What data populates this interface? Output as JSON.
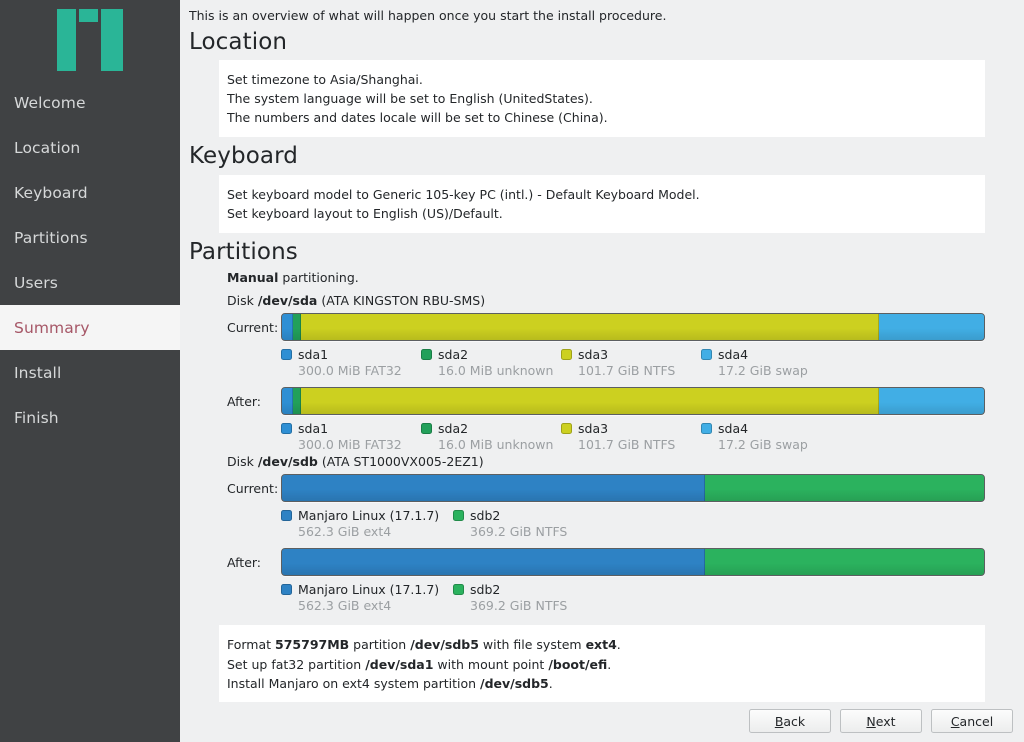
{
  "sidebar": {
    "logo_name": "manjaro-logo",
    "logo_color": "#2ab597",
    "background": "#404244",
    "items": [
      {
        "label": "Welcome",
        "active": false
      },
      {
        "label": "Location",
        "active": false
      },
      {
        "label": "Keyboard",
        "active": false
      },
      {
        "label": "Partitions",
        "active": false
      },
      {
        "label": "Users",
        "active": false
      },
      {
        "label": "Summary",
        "active": true
      },
      {
        "label": "Install",
        "active": false
      },
      {
        "label": "Finish",
        "active": false
      }
    ],
    "active_text_color": "#a65767",
    "active_bg_color": "#f5f5f5"
  },
  "main": {
    "intro": "This is an overview of what will happen once you start the install procedure.",
    "sections": {
      "location": {
        "title": "Location",
        "lines": [
          "Set timezone to Asia/Shanghai.",
          "The system language will be set to English (UnitedStates).",
          "The numbers and dates locale will be set to Chinese (China)."
        ]
      },
      "keyboard": {
        "title": "Keyboard",
        "lines": [
          "Set keyboard model to Generic 105-key PC (intl.) - Default Keyboard Model.",
          "Set keyboard layout to English (US)/Default."
        ]
      },
      "partitions": {
        "title": "Partitions",
        "mode_bold": "Manual",
        "mode_rest": " partitioning.",
        "current_label": "Current:",
        "after_label": "After:",
        "disks": [
          {
            "prefix": "Disk ",
            "device": "/dev/sda",
            "model": " (ATA KINGSTON RBU-SMS)",
            "current": [
              {
                "name": "sda1",
                "size": "300.0 MiB",
                "fs": "FAT32",
                "color": "#2e8fd4",
                "pct": 1.6
              },
              {
                "name": "sda2",
                "size": "16.0 MiB",
                "fs": "unknown",
                "color": "#22a05a",
                "pct": 1.1
              },
              {
                "name": "sda3",
                "size": "101.7 GiB",
                "fs": "NTFS",
                "color": "#ccd020",
                "pct": 82.3
              },
              {
                "name": "sda4",
                "size": "17.2 GiB",
                "fs": "swap",
                "color": "#41aee5",
                "pct": 15.0
              }
            ],
            "after": [
              {
                "name": "sda1",
                "size": "300.0 MiB",
                "fs": "FAT32",
                "color": "#2e8fd4",
                "pct": 1.6
              },
              {
                "name": "sda2",
                "size": "16.0 MiB",
                "fs": "unknown",
                "color": "#22a05a",
                "pct": 1.1
              },
              {
                "name": "sda3",
                "size": "101.7 GiB",
                "fs": "NTFS",
                "color": "#ccd020",
                "pct": 82.3
              },
              {
                "name": "sda4",
                "size": "17.2 GiB",
                "fs": "swap",
                "color": "#41aee5",
                "pct": 15.0
              }
            ]
          },
          {
            "prefix": "Disk ",
            "device": "/dev/sdb",
            "model": " (ATA ST1000VX005-2EZ1)",
            "current": [
              {
                "name": "Manjaro Linux (17.1.7)",
                "size": "562.3 GiB",
                "fs": "ext4",
                "color": "#2e82c4",
                "pct": 60.3
              },
              {
                "name": "sdb2",
                "size": "369.2 GiB",
                "fs": "NTFS",
                "color": "#2bb25e",
                "pct": 39.7
              }
            ],
            "after": [
              {
                "name": "Manjaro Linux (17.1.7)",
                "size": "562.3 GiB",
                "fs": "ext4",
                "color": "#2e82c4",
                "pct": 60.3
              },
              {
                "name": "sdb2",
                "size": "369.2 GiB",
                "fs": "NTFS",
                "color": "#2bb25e",
                "pct": 39.7
              }
            ]
          }
        ],
        "actions": [
          [
            {
              "t": "Format ",
              "b": false
            },
            {
              "t": "575797MB",
              "b": true
            },
            {
              "t": " partition ",
              "b": false
            },
            {
              "t": "/dev/sdb5",
              "b": true
            },
            {
              "t": " with file system ",
              "b": false
            },
            {
              "t": "ext4",
              "b": true
            },
            {
              "t": ".",
              "b": false
            }
          ],
          [
            {
              "t": "Set up fat32 partition ",
              "b": false
            },
            {
              "t": "/dev/sda1",
              "b": true
            },
            {
              "t": " with mount point ",
              "b": false
            },
            {
              "t": "/boot/efi",
              "b": true
            },
            {
              "t": ".",
              "b": false
            }
          ],
          [
            {
              "t": "Install Manjaro on ext4 system partition ",
              "b": false
            },
            {
              "t": "/dev/sdb5",
              "b": true
            },
            {
              "t": ".",
              "b": false
            }
          ]
        ]
      }
    }
  },
  "footer": {
    "buttons": [
      {
        "name": "back",
        "accel": "B",
        "rest": "ack"
      },
      {
        "name": "next",
        "accel": "N",
        "rest": "ext"
      },
      {
        "name": "cancel",
        "accel": "C",
        "rest": "ancel"
      }
    ]
  }
}
